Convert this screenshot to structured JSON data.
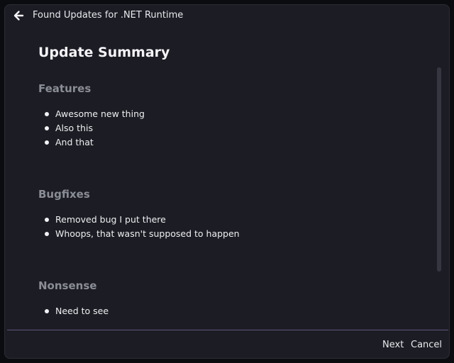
{
  "titlebar": {
    "title": "Found Updates for .NET Runtime",
    "back_icon": "arrow-left-icon"
  },
  "summary": {
    "title": "Update Summary",
    "sections": [
      {
        "heading": "Features",
        "items": [
          "Awesome new thing",
          "Also this",
          "And that"
        ]
      },
      {
        "heading": "Bugfixes",
        "items": [
          "Removed bug I put there",
          "Whoops, that wasn't supposed to happen"
        ]
      },
      {
        "heading": "Nonsense",
        "items": [
          "Need to see"
        ]
      }
    ]
  },
  "footer": {
    "next_label": "Next",
    "cancel_label": "Cancel"
  },
  "colors": {
    "window_background": "#1c1d24",
    "heading_text": "#8b8d96",
    "divider_accent": "#5e557c"
  }
}
